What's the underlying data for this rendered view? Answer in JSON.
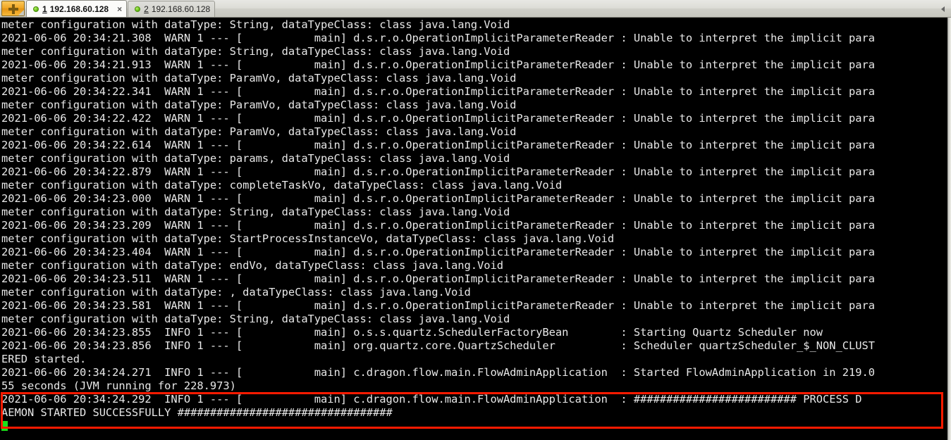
{
  "window": {
    "tabbar": {
      "new_tab_button": {
        "label": "+",
        "icon": "plus-icon"
      },
      "overflow_icon": "chevron-left-icon",
      "tabs": [
        {
          "index": "1",
          "title": "192.168.60.128",
          "status_icon": "green-connected-dot",
          "close_label": "×",
          "active": true
        },
        {
          "index": "2",
          "title": "192.168.60.128",
          "status_icon": "green-connected-dot",
          "close_label": "",
          "active": false
        }
      ]
    }
  },
  "terminal": {
    "cursor": "block-cursor-green",
    "cursor_color": "#19e019",
    "background_color": "#000000",
    "foreground_color": "#e8e8e8",
    "highlight_color": "#ff1a00",
    "lines": [
      "meter configuration with dataType: String, dataTypeClass: class java.lang.Void",
      "2021-06-06 20:34:21.308  WARN 1 --- [           main] d.s.r.o.OperationImplicitParameterReader : Unable to interpret the implicit para",
      "meter configuration with dataType: String, dataTypeClass: class java.lang.Void",
      "2021-06-06 20:34:21.913  WARN 1 --- [           main] d.s.r.o.OperationImplicitParameterReader : Unable to interpret the implicit para",
      "meter configuration with dataType: ParamVo, dataTypeClass: class java.lang.Void",
      "2021-06-06 20:34:22.341  WARN 1 --- [           main] d.s.r.o.OperationImplicitParameterReader : Unable to interpret the implicit para",
      "meter configuration with dataType: ParamVo, dataTypeClass: class java.lang.Void",
      "2021-06-06 20:34:22.422  WARN 1 --- [           main] d.s.r.o.OperationImplicitParameterReader : Unable to interpret the implicit para",
      "meter configuration with dataType: ParamVo, dataTypeClass: class java.lang.Void",
      "2021-06-06 20:34:22.614  WARN 1 --- [           main] d.s.r.o.OperationImplicitParameterReader : Unable to interpret the implicit para",
      "meter configuration with dataType: params, dataTypeClass: class java.lang.Void",
      "2021-06-06 20:34:22.879  WARN 1 --- [           main] d.s.r.o.OperationImplicitParameterReader : Unable to interpret the implicit para",
      "meter configuration with dataType: completeTaskVo, dataTypeClass: class java.lang.Void",
      "2021-06-06 20:34:23.000  WARN 1 --- [           main] d.s.r.o.OperationImplicitParameterReader : Unable to interpret the implicit para",
      "meter configuration with dataType: String, dataTypeClass: class java.lang.Void",
      "2021-06-06 20:34:23.209  WARN 1 --- [           main] d.s.r.o.OperationImplicitParameterReader : Unable to interpret the implicit para",
      "meter configuration with dataType: StartProcessInstanceVo, dataTypeClass: class java.lang.Void",
      "2021-06-06 20:34:23.404  WARN 1 --- [           main] d.s.r.o.OperationImplicitParameterReader : Unable to interpret the implicit para",
      "meter configuration with dataType: endVo, dataTypeClass: class java.lang.Void",
      "2021-06-06 20:34:23.511  WARN 1 --- [           main] d.s.r.o.OperationImplicitParameterReader : Unable to interpret the implicit para",
      "meter configuration with dataType: , dataTypeClass: class java.lang.Void",
      "2021-06-06 20:34:23.581  WARN 1 --- [           main] d.s.r.o.OperationImplicitParameterReader : Unable to interpret the implicit para",
      "meter configuration with dataType: String, dataTypeClass: class java.lang.Void",
      "2021-06-06 20:34:23.855  INFO 1 --- [           main] o.s.s.quartz.SchedulerFactoryBean        : Starting Quartz Scheduler now",
      "2021-06-06 20:34:23.856  INFO 1 --- [           main] org.quartz.core.QuartzScheduler          : Scheduler quartzScheduler_$_NON_CLUST",
      "ERED started.",
      "2021-06-06 20:34:24.271  INFO 1 --- [           main] c.dragon.flow.main.FlowAdminApplication  : Started FlowAdminApplication in 219.0",
      "55 seconds (JVM running for 228.973)"
    ],
    "highlighted_lines": [
      "2021-06-06 20:34:24.292  INFO 1 --- [           main] c.dragon.flow.main.FlowAdminApplication  : ######################### PROCESS D",
      "AEMON STARTED SUCCESSFULLY #################################"
    ]
  }
}
